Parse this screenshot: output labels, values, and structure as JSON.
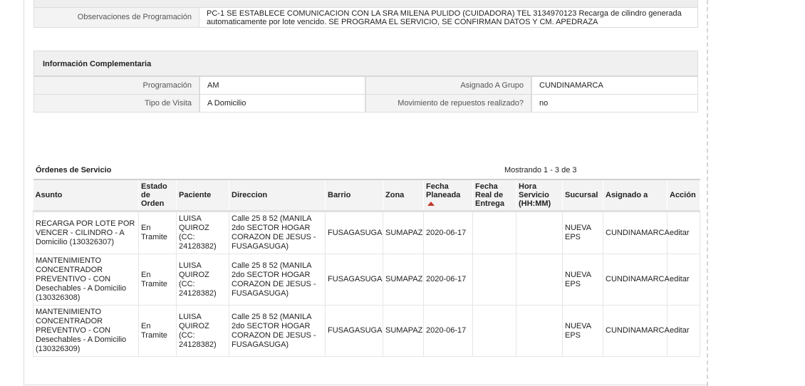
{
  "observaciones": {
    "label": "Observaciones de Programación",
    "value": "PC-1 SE ESTABLECE COMUNICACION CON LA SRA MILENA PULIDO (CUIDADORA) TEL 3134970123 Recarga de cilindro generada automaticamente por lote vencido. SE PROGRAMA EL SERVICIO, SE CONFIRMAN DATOS Y CM. APEDRAZA"
  },
  "info": {
    "title": "Información Complementaria",
    "programacion_label": "Programación",
    "programacion_value": "AM",
    "grupo_label": "Asignado A Grupo",
    "grupo_value": "CUNDINAMARCA",
    "visita_label": "Tipo de Visita",
    "visita_value": "A Domicilio",
    "repuestos_label": "Movimiento de repuestos realizado?",
    "repuestos_value": "no"
  },
  "ordenes": {
    "title": "Órdenes de Servicio",
    "count": "Mostrando 1 - 3 de 3",
    "headers": {
      "asunto": "Asunto",
      "estado": "Estado de Orden",
      "paciente": "Paciente",
      "direccion": "Direccion",
      "barrio": "Barrio",
      "zona": "Zona",
      "fecha_planeada": "Fecha Planeada",
      "fecha_real": "Fecha Real de Entrega",
      "hora": "Hora Servicio (HH:MM)",
      "sucursal": "Sucursal",
      "asignado": "Asignado a",
      "accion": "Acción"
    },
    "rows": [
      {
        "asunto": "RECARGA POR LOTE POR VENCER - CILINDRO - A Domicilio (130326307)",
        "estado": "En Tramite",
        "paciente": "LUISA QUIROZ (CC: 24128382)",
        "direccion": "Calle 25 8 52 (MANILA 2do SECTOR HOGAR CORAZON DE JESUS - FUSAGASUGA)",
        "barrio": "FUSAGASUGA",
        "zona": "SUMAPAZ",
        "fecha_planeada": "2020-06-17",
        "fecha_real": "",
        "hora": "",
        "sucursal": "NUEVA EPS",
        "asignado": "CUNDINAMARCA",
        "accion": "editar"
      },
      {
        "asunto": "MANTENIMIENTO CONCENTRADOR PREVENTIVO - CON Desechables - A Domicilio (130326308)",
        "estado": "En Tramite",
        "paciente": "LUISA QUIROZ (CC: 24128382)",
        "direccion": "Calle 25 8 52 (MANILA 2do SECTOR HOGAR CORAZON DE JESUS - FUSAGASUGA)",
        "barrio": "FUSAGASUGA",
        "zona": "SUMAPAZ",
        "fecha_planeada": "2020-06-17",
        "fecha_real": "",
        "hora": "",
        "sucursal": "NUEVA EPS",
        "asignado": "CUNDINAMARCA",
        "accion": "editar"
      },
      {
        "asunto": "MANTENIMIENTO CONCENTRADOR PREVENTIVO - CON Desechables - A Domicilio (130326309)",
        "estado": "En Tramite",
        "paciente": "LUISA QUIROZ (CC: 24128382)",
        "direccion": "Calle 25 8 52 (MANILA 2do SECTOR HOGAR CORAZON DE JESUS - FUSAGASUGA)",
        "barrio": "FUSAGASUGA",
        "zona": "SUMAPAZ",
        "fecha_planeada": "2020-06-17",
        "fecha_real": "",
        "hora": "",
        "sucursal": "NUEVA EPS",
        "asignado": "CUNDINAMARCA",
        "accion": "editar"
      }
    ]
  },
  "icons": {
    "sort": "sort-ascending-icon"
  },
  "colors": {
    "sort_arrow": "#c0392b",
    "label_bg": "#f3f3f3",
    "border": "#dcdcdc"
  }
}
